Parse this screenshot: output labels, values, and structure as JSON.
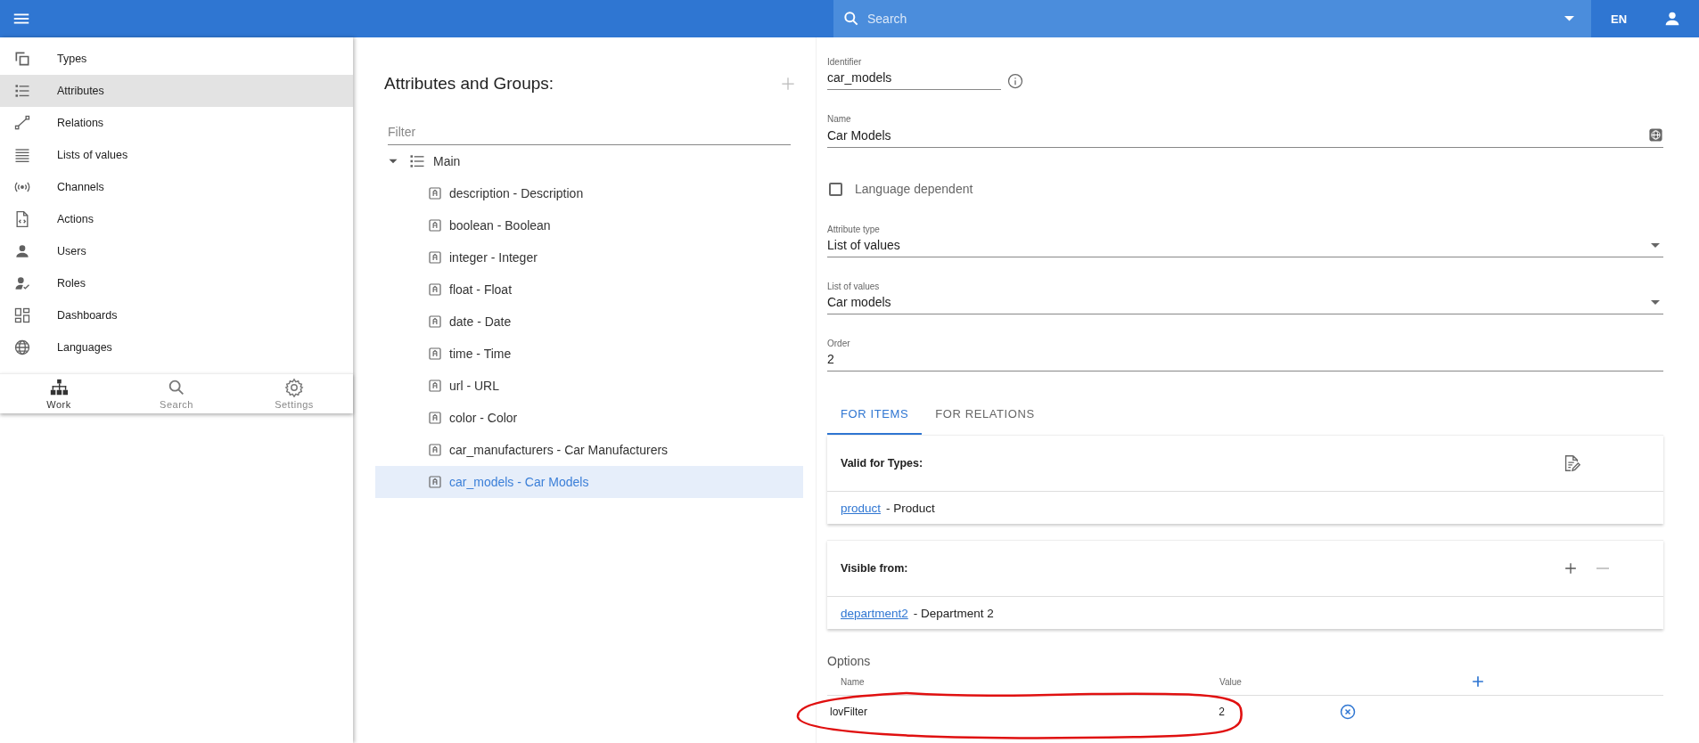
{
  "top_bar": {
    "search": {
      "placeholder": "Search"
    },
    "language": "EN"
  },
  "sidebar": {
    "items": [
      {
        "label": "Types",
        "selected": false
      },
      {
        "label": "Attributes",
        "selected": true
      },
      {
        "label": "Relations",
        "selected": false
      },
      {
        "label": "Lists of values",
        "selected": false
      },
      {
        "label": "Channels",
        "selected": false
      },
      {
        "label": "Actions",
        "selected": false
      },
      {
        "label": "Users",
        "selected": false
      },
      {
        "label": "Roles",
        "selected": false
      },
      {
        "label": "Dashboards",
        "selected": false
      },
      {
        "label": "Languages",
        "selected": false
      }
    ],
    "bottom_nav": [
      {
        "label": "Work",
        "selected": true
      },
      {
        "label": "Search",
        "selected": false
      },
      {
        "label": "Settings",
        "selected": false
      }
    ]
  },
  "tree": {
    "title": "Attributes and Groups:",
    "filter": {
      "placeholder": "Filter"
    },
    "items": [
      {
        "label": "Main",
        "expanded": true,
        "children": [
          {
            "label": "description - Description",
            "selected": false
          },
          {
            "label": "boolean - Boolean",
            "selected": false
          },
          {
            "label": "integer - Integer",
            "selected": false
          },
          {
            "label": "float - Float",
            "selected": false
          },
          {
            "label": "date - Date",
            "selected": false
          },
          {
            "label": "time - Time",
            "selected": false
          },
          {
            "label": "url - URL",
            "selected": false
          },
          {
            "label": "color - Color",
            "selected": false
          },
          {
            "label": "car_manufacturers - Car Manufacturers",
            "selected": false
          },
          {
            "label": "car_models - Car Models",
            "selected": true
          }
        ]
      }
    ]
  },
  "form": {
    "fields": [
      {
        "kind": "identifier",
        "label": "Identifier",
        "value": "car_models"
      },
      {
        "kind": "translatable",
        "label": "Name",
        "value": "Car Models"
      },
      {
        "kind": "checkbox",
        "label": "Language dependent",
        "checked": false
      },
      {
        "kind": "select",
        "label": "Attribute type",
        "value": "List of values"
      },
      {
        "kind": "select",
        "label": "List of values",
        "value": "Car models"
      },
      {
        "kind": "text",
        "label": "Order",
        "value": "2"
      }
    ],
    "tabs": [
      {
        "label": "FOR ITEMS",
        "selected": true
      },
      {
        "label": "FOR RELATIONS",
        "selected": false
      }
    ],
    "cards": [
      {
        "kind": "edit",
        "title": "Valid for Types:",
        "rows": [
          {
            "link": "product",
            "text": "- Product"
          }
        ]
      },
      {
        "kind": "addremove",
        "title": "Visible from:",
        "rows": [
          {
            "link": "department2",
            "text": "- Department 2"
          }
        ]
      }
    ],
    "options": {
      "title": "Options",
      "columns": [
        "Name",
        "Value"
      ],
      "rows": [
        {
          "name": "lovFilter",
          "value": "2",
          "circled": true
        }
      ]
    }
  }
}
